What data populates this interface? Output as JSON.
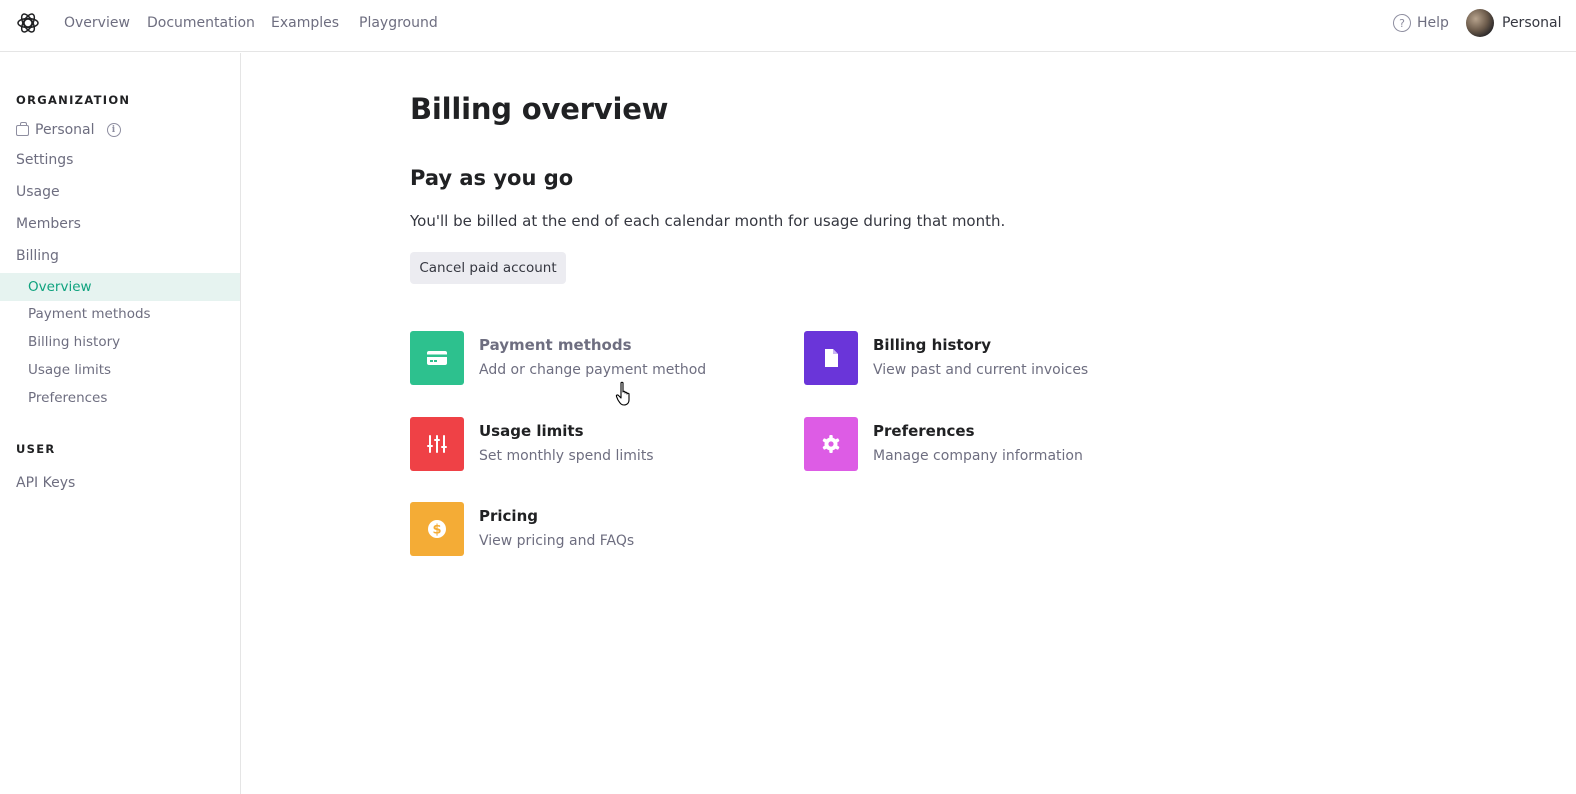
{
  "topnav": {
    "logo": "openai-logo-icon",
    "links": [
      "Overview",
      "Documentation",
      "Examples",
      "Playground"
    ],
    "help_label": "Help",
    "help_icon": "?",
    "account_label": "Personal"
  },
  "sidebar": {
    "organization_heading": "ORGANIZATION",
    "org_name": "Personal",
    "info_glyph": "i",
    "items": [
      "Settings",
      "Usage",
      "Members",
      "Billing"
    ],
    "billing_subitems": [
      "Overview",
      "Payment methods",
      "Billing history",
      "Usage limits",
      "Preferences"
    ],
    "active_subitem": "Overview",
    "user_heading": "USER",
    "user_items": [
      "API Keys"
    ]
  },
  "main": {
    "title": "Billing overview",
    "plan_title": "Pay as you go",
    "plan_description": "You'll be billed at the end of each calendar month for usage during that month.",
    "cancel_button": "Cancel paid account",
    "cards": [
      {
        "title": "Payment methods",
        "subtitle": "Add or change payment method",
        "icon": "credit-card-icon",
        "color": "#2dc18e"
      },
      {
        "title": "Billing history",
        "subtitle": "View past and current invoices",
        "icon": "document-icon",
        "color": "#6a35d9"
      },
      {
        "title": "Usage limits",
        "subtitle": "Set monthly spend limits",
        "icon": "sliders-icon",
        "color": "#ef4146"
      },
      {
        "title": "Preferences",
        "subtitle": "Manage company information",
        "icon": "gear-icon",
        "color": "#dd5ce5"
      },
      {
        "title": "Pricing",
        "subtitle": "View pricing and FAQs",
        "icon": "dollar-icon",
        "color": "#f4ac36"
      }
    ]
  },
  "colors": {
    "accent": "#10a37f",
    "active_bg": "#e6f3f0"
  }
}
